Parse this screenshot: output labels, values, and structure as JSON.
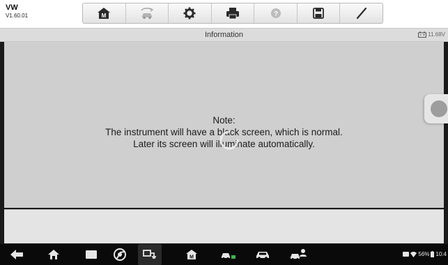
{
  "vehicle": {
    "make": "VW",
    "version": "V1.60.01"
  },
  "toolbar": {
    "buttons": [
      {
        "icon": "home-icon"
      },
      {
        "icon": "vehicle-swap-icon",
        "disabled": true
      },
      {
        "icon": "settings-icon"
      },
      {
        "icon": "print-icon"
      },
      {
        "icon": "help-icon",
        "disabled": true
      },
      {
        "icon": "save-icon"
      },
      {
        "icon": "edit-icon"
      }
    ]
  },
  "header": {
    "title": "Information",
    "voltage": "11.68V"
  },
  "message": {
    "line1": "Note:",
    "line2": "The instrument will have a black screen, which is normal.",
    "line3": "Later its screen will illuminate automatically."
  },
  "status": {
    "battery": "56%",
    "time": "10:4"
  },
  "colors": {
    "content_bg": "#cfcfcf",
    "navbar_bg": "#0a0a0a",
    "toolbar_icon": "#2b2b2b"
  }
}
